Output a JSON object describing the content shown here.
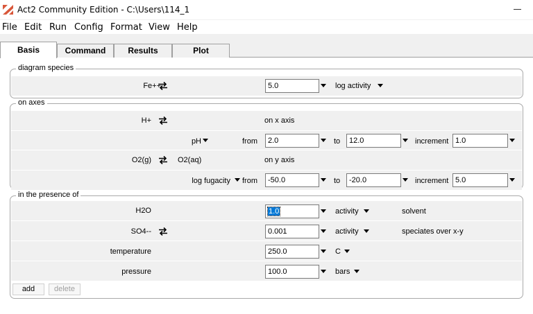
{
  "window": {
    "title": "Act2 Community Edition - C:\\Users\\114_1"
  },
  "menu": [
    "File",
    "Edit",
    "Run",
    "Config",
    "Format",
    "View",
    "Help"
  ],
  "tabs": [
    "Basis",
    "Command",
    "Results",
    "Plot"
  ],
  "diagram_species": {
    "title": "diagram species",
    "species": "Fe++",
    "value": "5.0",
    "unit": "log activity"
  },
  "axes": {
    "title": "on axes",
    "x": {
      "species": "H+",
      "note": "on x axis",
      "variable": "pH",
      "from_label": "from",
      "from": "2.0",
      "to_label": "to",
      "to": "12.0",
      "increment_label": "increment",
      "increment": "1.0"
    },
    "y": {
      "species": "O2(g)",
      "alt_species": "O2(aq)",
      "note": "on y axis",
      "variable": "log fugacity",
      "from_label": "from",
      "from": "-50.0",
      "to_label": "to",
      "to": "-20.0",
      "increment_label": "increment",
      "increment": "5.0"
    }
  },
  "presence": {
    "title": "in the presence of",
    "rows": [
      {
        "name": "H2O",
        "value": "1.0",
        "unit": "activity",
        "note": "solvent"
      },
      {
        "name": "SO4--",
        "value": "0.001",
        "unit": "activity",
        "note": "speciates over x-y"
      },
      {
        "name": "temperature",
        "value": "250.0",
        "unit": "C",
        "note": ""
      },
      {
        "name": "pressure",
        "value": "100.0",
        "unit": "bars",
        "note": ""
      }
    ],
    "add_label": "add",
    "delete_label": "delete"
  },
  "colors": {
    "selection": "#0078d7",
    "logo": "#d9573a"
  }
}
